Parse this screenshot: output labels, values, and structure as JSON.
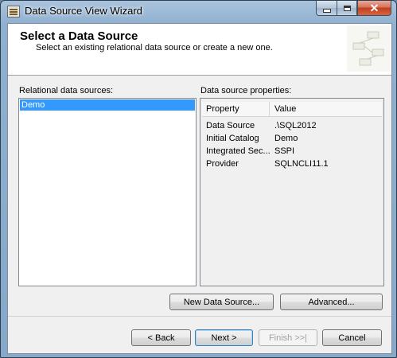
{
  "window": {
    "title": "Data Source View Wizard",
    "close_glyph": "✕"
  },
  "header": {
    "title": "Select a Data Source",
    "subtitle": "Select an existing relational data source or create a new one."
  },
  "left": {
    "label": "Relational data sources:",
    "items": [
      {
        "label": "Demo",
        "selected": true
      }
    ]
  },
  "right": {
    "label": "Data source properties:",
    "columns": {
      "property": "Property",
      "value": "Value"
    },
    "rows": [
      {
        "property": "Data Source",
        "value": ".\\SQL2012"
      },
      {
        "property": "Initial Catalog",
        "value": "Demo"
      },
      {
        "property": "Integrated Sec...",
        "value": "SSPI"
      },
      {
        "property": "Provider",
        "value": "SQLNCLI11.1"
      }
    ]
  },
  "actions": {
    "new_ds": "New Data Source...",
    "advanced": "Advanced..."
  },
  "nav": {
    "back": "< Back",
    "next": "Next >",
    "finish": "Finish >>|",
    "cancel": "Cancel"
  },
  "colors": {
    "selection": "#3399ff",
    "frame": "#8fb0cf",
    "close": "#c0401f"
  }
}
